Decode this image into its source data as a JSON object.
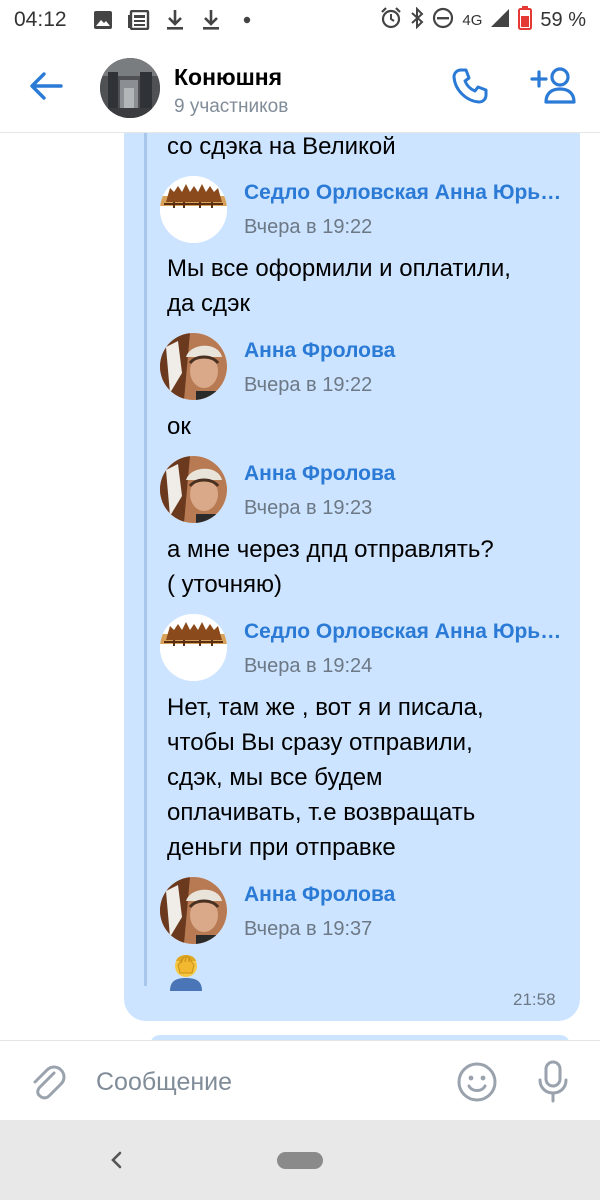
{
  "status_bar": {
    "time": "04:12",
    "network": "4G",
    "battery": "59 %",
    "icons": [
      "gallery-icon",
      "news-icon",
      "download-icon",
      "download-icon",
      "dot-icon",
      "alarm-icon",
      "bluetooth-icon",
      "dnd-icon",
      "signal-icon",
      "battery-icon"
    ]
  },
  "header": {
    "title": "Конюшня",
    "subtitle": "9 участников",
    "icons": [
      "back-arrow-icon",
      "phone-icon",
      "add-user-icon"
    ]
  },
  "colors": {
    "accent": "#2a7ad6",
    "bubble": "#cce4ff",
    "secondary_text": "#818c99"
  },
  "messages": {
    "items": [
      {
        "type": "text",
        "lines": [
          "со сдэка на Великой"
        ]
      },
      {
        "type": "author",
        "name": "Седло Орловская Анна Юрьевна",
        "time": "Вчера в 19:22",
        "avatar": "horses-logo"
      },
      {
        "type": "text",
        "lines": [
          "Мы все оформили и оплатили,",
          "да сдэк"
        ]
      },
      {
        "type": "author",
        "name": "Анна Фролова",
        "time": "Вчера в 19:22",
        "avatar": "girl-with-horse"
      },
      {
        "type": "text",
        "lines": [
          "ок"
        ]
      },
      {
        "type": "author",
        "name": "Анна Фролова",
        "time": "Вчера в 19:23",
        "avatar": "girl-with-horse"
      },
      {
        "type": "text",
        "lines": [
          "а мне через дпд отправлять?",
          "( уточняю)"
        ]
      },
      {
        "type": "author",
        "name": "Седло Орловская Анна Юрьевна",
        "time": "Вчера в 19:24",
        "avatar": "horses-logo"
      },
      {
        "type": "text",
        "lines": [
          "Нет, там же , вот я и писала,",
          "чтобы Вы сразу отправили,",
          "сдэк, мы все будем",
          "оплачивать, т.е возвращать",
          "деньги при отправке"
        ]
      },
      {
        "type": "author",
        "name": "Анна Фролова",
        "time": "Вчера в 19:37",
        "avatar": "girl-with-horse"
      },
      {
        "type": "emoji",
        "icon": "facepalm-emoji-icon"
      }
    ],
    "bubble_time": "21:58"
  },
  "composer": {
    "placeholder": "Сообщение",
    "icons": [
      "paperclip-icon",
      "smiley-icon",
      "microphone-icon"
    ]
  },
  "navbar": {
    "icons": [
      "nav-back-icon",
      "nav-home-pill"
    ]
  }
}
